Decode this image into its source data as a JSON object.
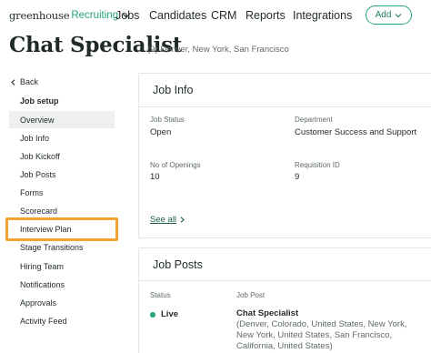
{
  "nav": {
    "logo_main": "greenhouse",
    "logo_product": "Recruiting",
    "links": [
      "Jobs",
      "Candidates",
      "CRM",
      "Reports",
      "Integrations"
    ],
    "add_label": "Add"
  },
  "header": {
    "title": "Chat Specialist",
    "meta": "(9)  Denver, New York, San Francisco"
  },
  "sidebar": {
    "back_label": "Back",
    "section_heading": "Job setup",
    "items": [
      {
        "label": "Overview",
        "active": true
      },
      {
        "label": "Job Info"
      },
      {
        "label": "Job Kickoff"
      },
      {
        "label": "Job Posts"
      },
      {
        "label": "Forms"
      },
      {
        "label": "Scorecard"
      },
      {
        "label": "Interview Plan",
        "highlighted": true
      },
      {
        "label": "Stage Transitions"
      },
      {
        "label": "Hiring Team"
      },
      {
        "label": "Notifications"
      },
      {
        "label": "Approvals"
      },
      {
        "label": "Activity Feed"
      }
    ]
  },
  "job_info": {
    "title": "Job Info",
    "status_label": "Job Status",
    "status_value": "Open",
    "department_label": "Department",
    "department_value": "Customer Success and Support",
    "openings_label": "No of Openings",
    "openings_value": "10",
    "requisition_label": "Requisition ID",
    "requisition_value": "9",
    "see_all_label": "See all"
  },
  "job_posts": {
    "title": "Job Posts",
    "status_header": "Status",
    "post_header": "Job Post",
    "rows": [
      {
        "status": "Live",
        "post_title": "Chat Specialist",
        "post_locations": "(Denver, Colorado, United States, New York, New York, United States, San Francisco, California, United States)"
      }
    ]
  },
  "colors": {
    "brand_green": "#24a47f",
    "highlight_orange": "#f7a330",
    "active_bg": "#eef0ee"
  }
}
